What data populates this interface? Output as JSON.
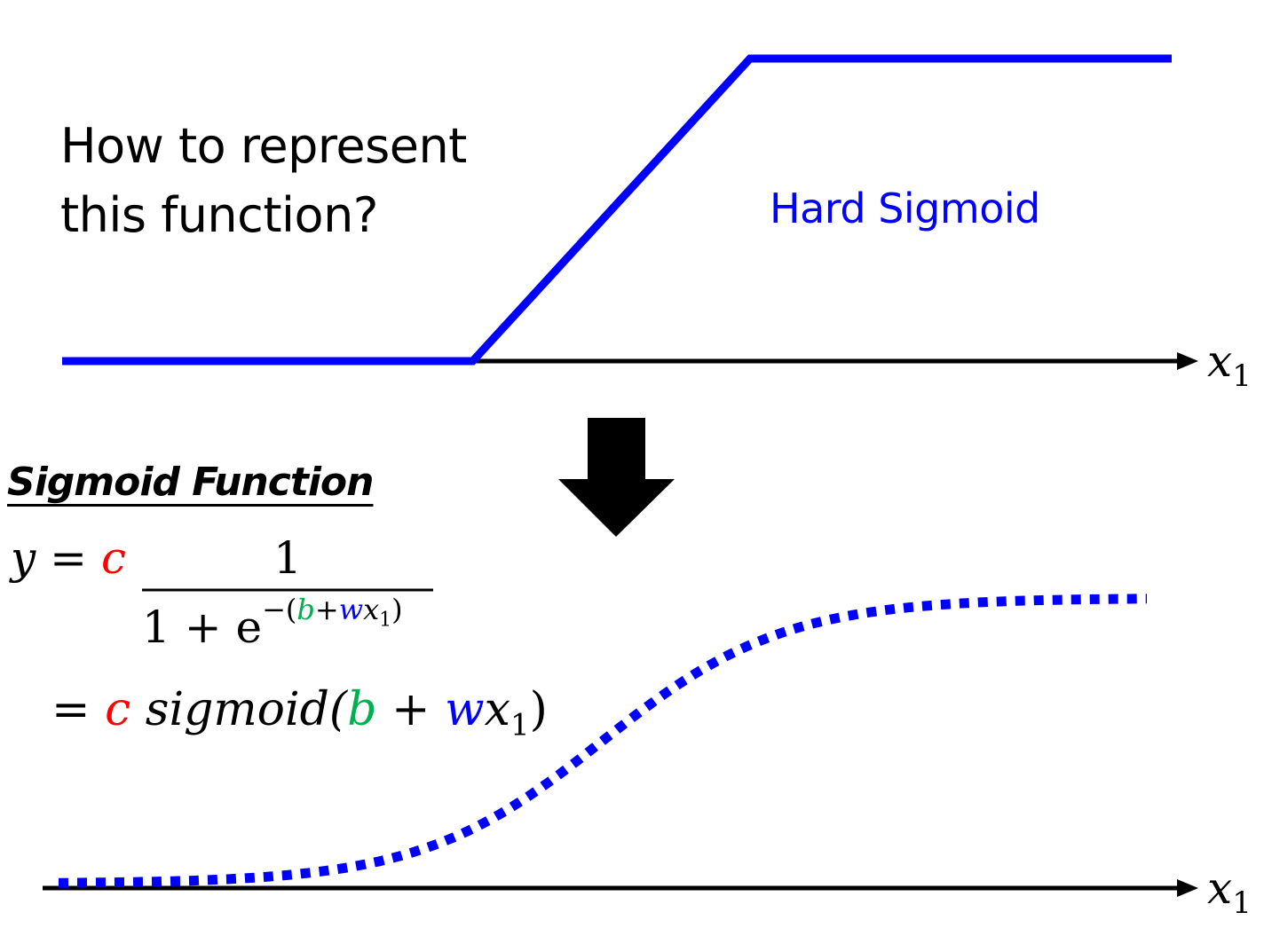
{
  "top_panel": {
    "question_line1": "How to represent",
    "question_line2": "this function?",
    "curve_label": "Hard Sigmoid",
    "axis_label": "x",
    "axis_subscript": "1"
  },
  "arrow": {
    "icon": "down-arrow-icon"
  },
  "bottom_panel": {
    "heading": "Sigmoid Function",
    "equation_1": {
      "lhs": "y",
      "equals": "=",
      "c": "c",
      "numerator": "1",
      "denominator_base": "1 + e",
      "exponent_prefix": "−(",
      "b": "b",
      "plus": "+",
      "w": "w",
      "x": "x",
      "sub": "1",
      "close": ")"
    },
    "equation_2": {
      "equals": "=",
      "c": "c",
      "func": "sigmoid(",
      "b": "b",
      "plus": " + ",
      "w": "w",
      "x": "x",
      "sub": "1",
      "close": ")"
    },
    "axis_label": "x",
    "axis_subscript": "1"
  },
  "colors": {
    "curve": "#0000ff",
    "c_param": "#ff0000",
    "b_param": "#00b050",
    "w_param": "#0000ff",
    "axis": "#000000"
  },
  "chart_data": [
    {
      "type": "line",
      "title": "Hard Sigmoid",
      "xlabel": "x1",
      "ylabel": "",
      "series": [
        {
          "name": "Hard Sigmoid",
          "style": "solid",
          "x": [
            0,
            0.37,
            0.62,
            1.0
          ],
          "y": [
            0,
            0,
            1,
            1
          ]
        }
      ],
      "xlim": [
        0,
        1
      ],
      "ylim": [
        0,
        1
      ],
      "grid": false
    },
    {
      "type": "line",
      "title": "Sigmoid",
      "xlabel": "x1",
      "ylabel": "",
      "series": [
        {
          "name": "c sigmoid(b + w x1)",
          "style": "dotted",
          "x_range": [
            0,
            1
          ],
          "center": 0.5,
          "steepness": 12,
          "c": 1
        }
      ],
      "xlim": [
        0,
        1
      ],
      "ylim": [
        0,
        1
      ],
      "grid": false
    }
  ]
}
